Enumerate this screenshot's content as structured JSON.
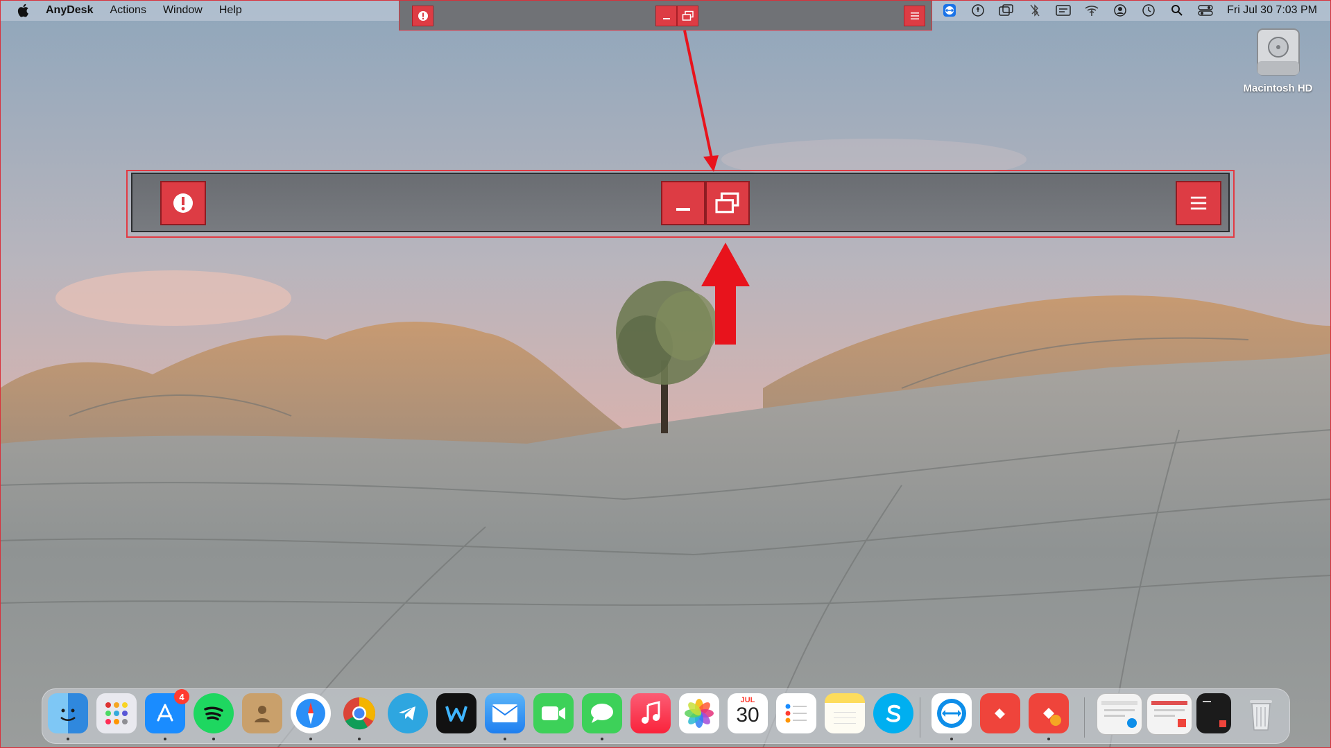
{
  "menubar": {
    "app_name": "AnyDesk",
    "menus": [
      "Actions",
      "Window",
      "Help"
    ],
    "clock": "Fri Jul 30  7:03 PM"
  },
  "desktop": {
    "disk_label": "Macintosh HD"
  },
  "dock": {
    "app_store_badge": "4",
    "calendar_month": "JUL",
    "calendar_day": "30"
  },
  "colors": {
    "toolbar_button": "#dd3c44",
    "annotation_red": "#e8131c",
    "toolbar_bg": "#707276"
  },
  "icons": [
    "apple-icon",
    "info-icon",
    "minimize-icon",
    "restore-window-icon",
    "hamburger-menu-icon"
  ]
}
